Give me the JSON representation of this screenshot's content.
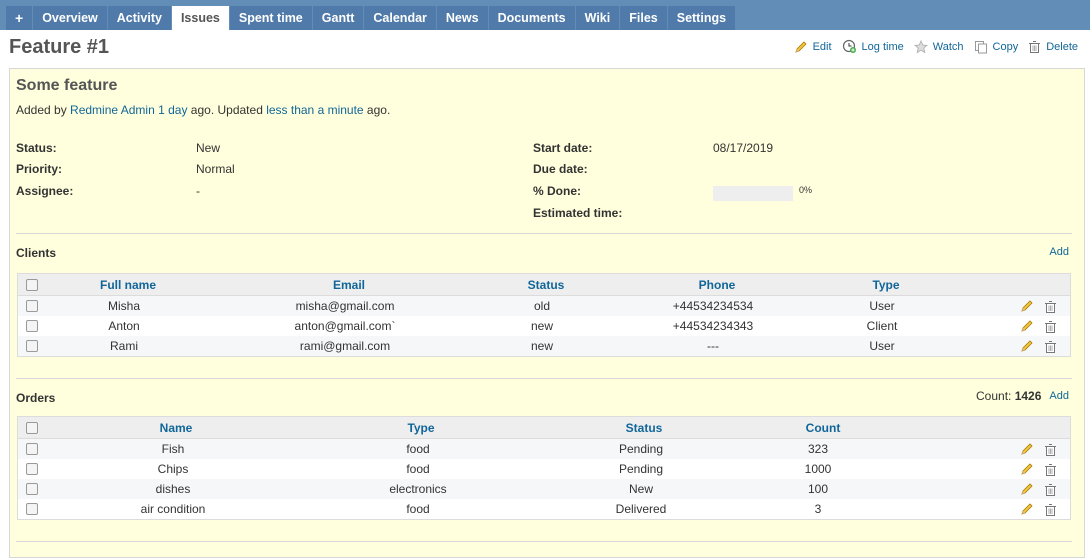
{
  "nav": {
    "new_label": "+",
    "tabs": [
      "Overview",
      "Activity",
      "Issues",
      "Spent time",
      "Gantt",
      "Calendar",
      "News",
      "Documents",
      "Wiki",
      "Files",
      "Settings"
    ],
    "selected": "Issues"
  },
  "title": "Feature #1",
  "actions": {
    "edit": "Edit",
    "log_time": "Log time",
    "watch": "Watch",
    "copy": "Copy",
    "delete": "Delete"
  },
  "issue": {
    "subject": "Some feature",
    "added_by_prefix": "Added by ",
    "author": "Redmine Admin",
    "created_ago": "1 day",
    "ago_updated": " ago. Updated ",
    "updated_ago": "less than a minute",
    "ago_end": " ago.",
    "attributes": {
      "status_label": "Status:",
      "status": "New",
      "priority_label": "Priority:",
      "priority": "Normal",
      "assignee_label": "Assignee:",
      "assignee": "-",
      "start_date_label": "Start date:",
      "start_date": "08/17/2019",
      "due_date_label": "Due date:",
      "due_date": "",
      "done_label": "% Done:",
      "done": "0%",
      "done_value": 0,
      "estimated_label": "Estimated time:",
      "estimated": ""
    }
  },
  "clients": {
    "title": "Clients",
    "add_label": "Add",
    "columns": [
      "Full name",
      "Email",
      "Status",
      "Phone",
      "Type"
    ],
    "rows": [
      [
        "Misha",
        "misha@gmail.com",
        "old",
        "+44534234534",
        "User"
      ],
      [
        "Anton",
        "anton@gmail.com`",
        "new",
        "+44534234343",
        "Client"
      ],
      [
        "Rami",
        "rami@gmail.com",
        "new",
        "---",
        "User"
      ]
    ]
  },
  "orders": {
    "title": "Orders",
    "count_label": "Count:",
    "count_value": "1426",
    "add_label": "Add",
    "columns": [
      "Name",
      "Type",
      "Status",
      "Count"
    ],
    "rows": [
      [
        "Fish",
        "food",
        "Pending",
        "323"
      ],
      [
        "Chips",
        "food",
        "Pending",
        "1000"
      ],
      [
        "dishes",
        "electronics",
        "New",
        "100"
      ],
      [
        "air condition",
        "food",
        "Delivered",
        "3"
      ]
    ]
  }
}
